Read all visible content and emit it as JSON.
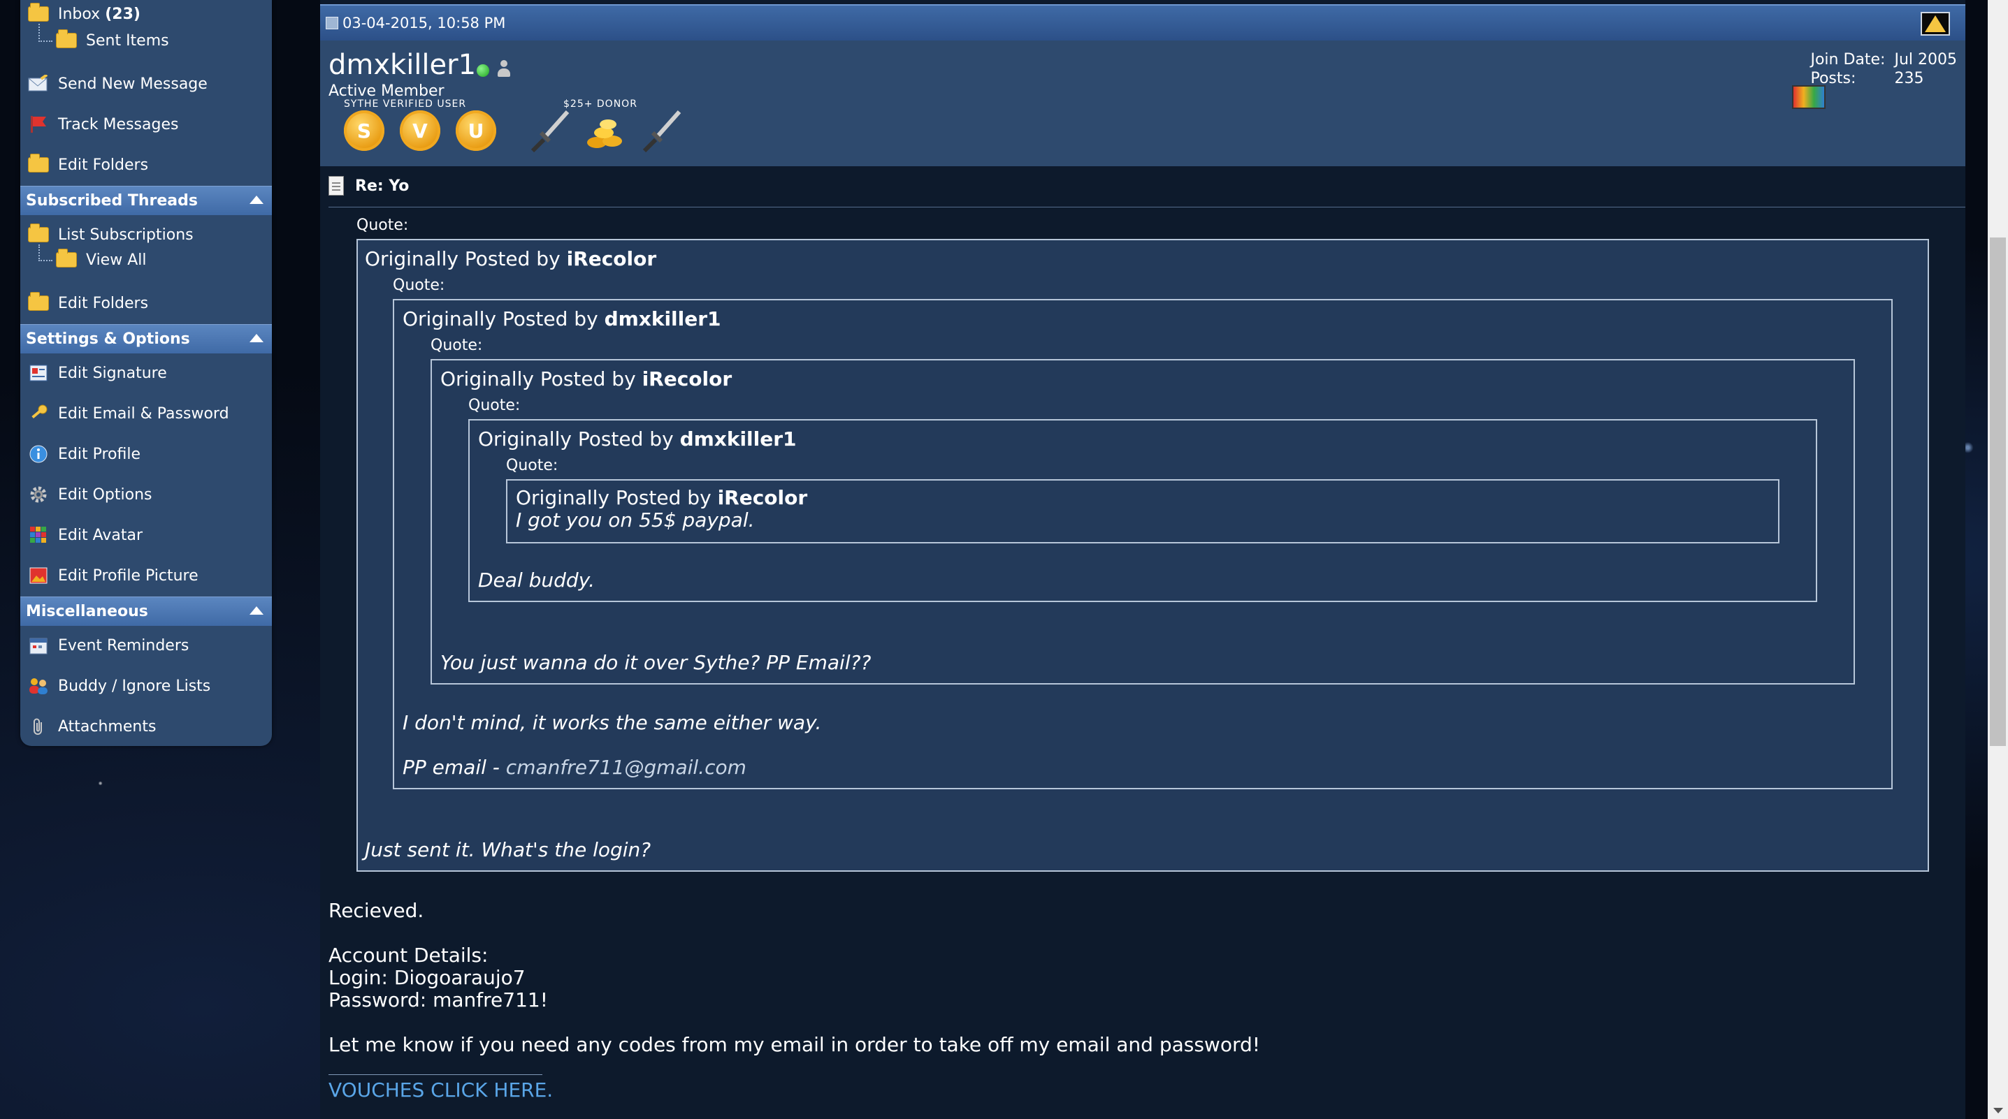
{
  "sidebar": {
    "inbox": {
      "label": "Inbox",
      "count": "(23)"
    },
    "sent_items": "Sent Items",
    "send_new_message": "Send New Message",
    "track_messages": "Track Messages",
    "edit_folders_pm": "Edit Folders",
    "subscribed_threads": {
      "heading": "Subscribed Threads",
      "list_subscriptions": "List Subscriptions",
      "view_all": "View All",
      "edit_folders": "Edit Folders"
    },
    "settings_options": {
      "heading": "Settings & Options",
      "items": [
        "Edit Signature",
        "Edit Email & Password",
        "Edit Profile",
        "Edit Options",
        "Edit Avatar",
        "Edit Profile Picture"
      ]
    },
    "miscellaneous": {
      "heading": "Miscellaneous",
      "items": [
        "Event Reminders",
        "Buddy / Ignore Lists",
        "Attachments"
      ]
    }
  },
  "post": {
    "date": "03-04-2015, 10:58 PM",
    "username": "dmxkiller1",
    "usertitle": "Active Member",
    "badges": {
      "caption1": "SYTHE VERIFIED USER",
      "medal_letters": [
        "S",
        "V",
        "U"
      ],
      "caption2": "$25+ DONOR"
    },
    "join_date_label": "Join Date:",
    "join_date": "Jul 2005",
    "posts_label": "Posts:",
    "posts": "235",
    "title": "Re: Yo",
    "quote_label": "Quote:",
    "originally_posted_by": "Originally Posted by",
    "quotes": {
      "q1_author": "iRecolor",
      "q2_author": "dmxkiller1",
      "q3_author": "iRecolor",
      "q4_author": "dmxkiller1",
      "q5_author": "iRecolor",
      "q5_text": "I got you on 55$ paypal.",
      "q4_text": "Deal buddy.",
      "q3_text": "You just wanna do it over Sythe? PP Email??",
      "q2_text1": "I don't mind, it works the same either way.",
      "q2_text2_prefix": "PP email - ",
      "q2_email": "cmanfre711@gmail.com",
      "q1_text": "Just sent it. What's the login?"
    },
    "body": {
      "line1": "Recieved.",
      "line2": "Account Details:",
      "line3": "Login: Diogoaraujo7",
      "line4": "Password: manfre711!",
      "line5": "Let me know if you need any codes from my email in order to take off my email and password!"
    },
    "signature_link": "VOUCHES CLICK HERE."
  },
  "colors": {
    "sidebar_bg": "#2e4a6e",
    "section_header": "#4a76b3",
    "post_bg": "#0d1a2c",
    "quote_bg": "#233a5a",
    "link": "#5aa6e8"
  }
}
